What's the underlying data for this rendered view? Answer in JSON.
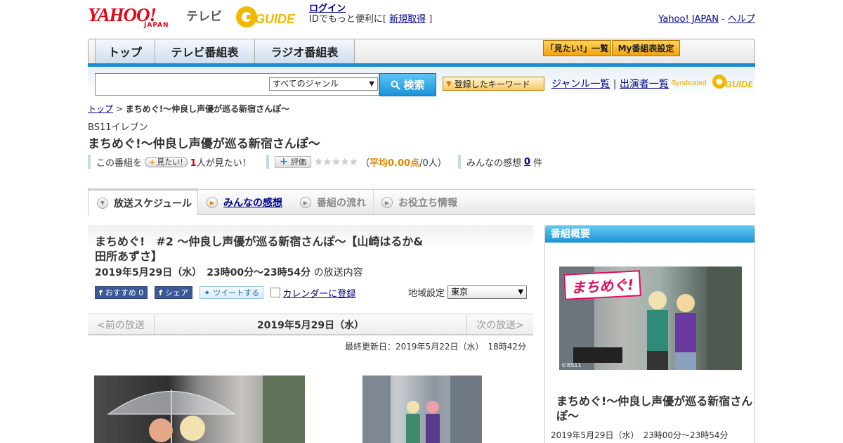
{
  "header": {
    "yahoo_logo": "YAHOO!",
    "japan_label": "JAPAN",
    "tv_label": "テレビ",
    "gguide_label": "GUIDE",
    "login_label": "ログイン",
    "login_sub_prefix": "IDでもっと便利に[ ",
    "signup_label": "新規取得",
    "login_sub_suffix": " ]",
    "yahoo_japan_link": "Yahoo! JAPAN",
    "separator": " - ",
    "help_link": "ヘルプ"
  },
  "nav": {
    "tabs": [
      "トップ",
      "テレビ番組表",
      "ラジオ番組表"
    ],
    "mitai_list": "「見たい!」一覧",
    "my_schedule": "My番組表設定"
  },
  "search": {
    "genre_value": "すべてのジャンル",
    "search_button": "検索",
    "keyword_button": "登録したキーワード",
    "genre_list_link": "ジャンル一覧",
    "divider": "|",
    "cast_list_link": "出演者一覧",
    "syndicated": "Syndicated"
  },
  "breadcrumb": {
    "top": "トップ",
    "sep": " > ",
    "current": "まちめぐ!～仲良し声優が巡る新宿さんぽ～"
  },
  "program": {
    "channel": "BS11イレブン",
    "title": "まちめぐ!～仲良し声優が巡る新宿さんぽ～",
    "this_program": "この番組を",
    "mitai_button": "見たい!",
    "mitai_count": "1",
    "mitai_suffix": "人が見たい！",
    "hyoka_button": "評価",
    "stars": "★★★★★",
    "avg_open": "（",
    "avg_label": "平均0.00点",
    "avg_count": "/0人）",
    "impressions_label": "みんなの感想",
    "impressions_count": "0",
    "impressions_suffix": "件"
  },
  "tabs": [
    {
      "label": "放送スケジュール"
    },
    {
      "label": "みんなの感想"
    },
    {
      "label": "番組の流れ"
    },
    {
      "label": "お役立ち情報"
    }
  ],
  "episode": {
    "title": "まちめぐ!　#2 ～仲良し声優が巡る新宿さんぽ～【山崎はるか&田所あずさ】",
    "date_time": "2019年5月29日（水）　23時00分～23時54分",
    "date_suffix": "の放送内容",
    "fb_recommend": "おすすめ 0",
    "fb_share": "シェア",
    "tweet": "ツイートする",
    "calendar": "カレンダーに登録",
    "region_label": "地域設定",
    "region_value": "東京"
  },
  "pager": {
    "prev": "<前の放送",
    "current": "2019年5月29日（水）",
    "next": "次の放送>"
  },
  "updated": "最終更新日：2019年5月22日（水）　18時42分",
  "sidebar": {
    "heading": "番組概要",
    "image_logo": "まちめぐ!",
    "image_copyright": "©BS11",
    "title": "まちめぐ!～仲良し声優が巡る新宿さんぽ～",
    "date_time": "2019年5月29日（水）　23時00分～23時54分"
  }
}
